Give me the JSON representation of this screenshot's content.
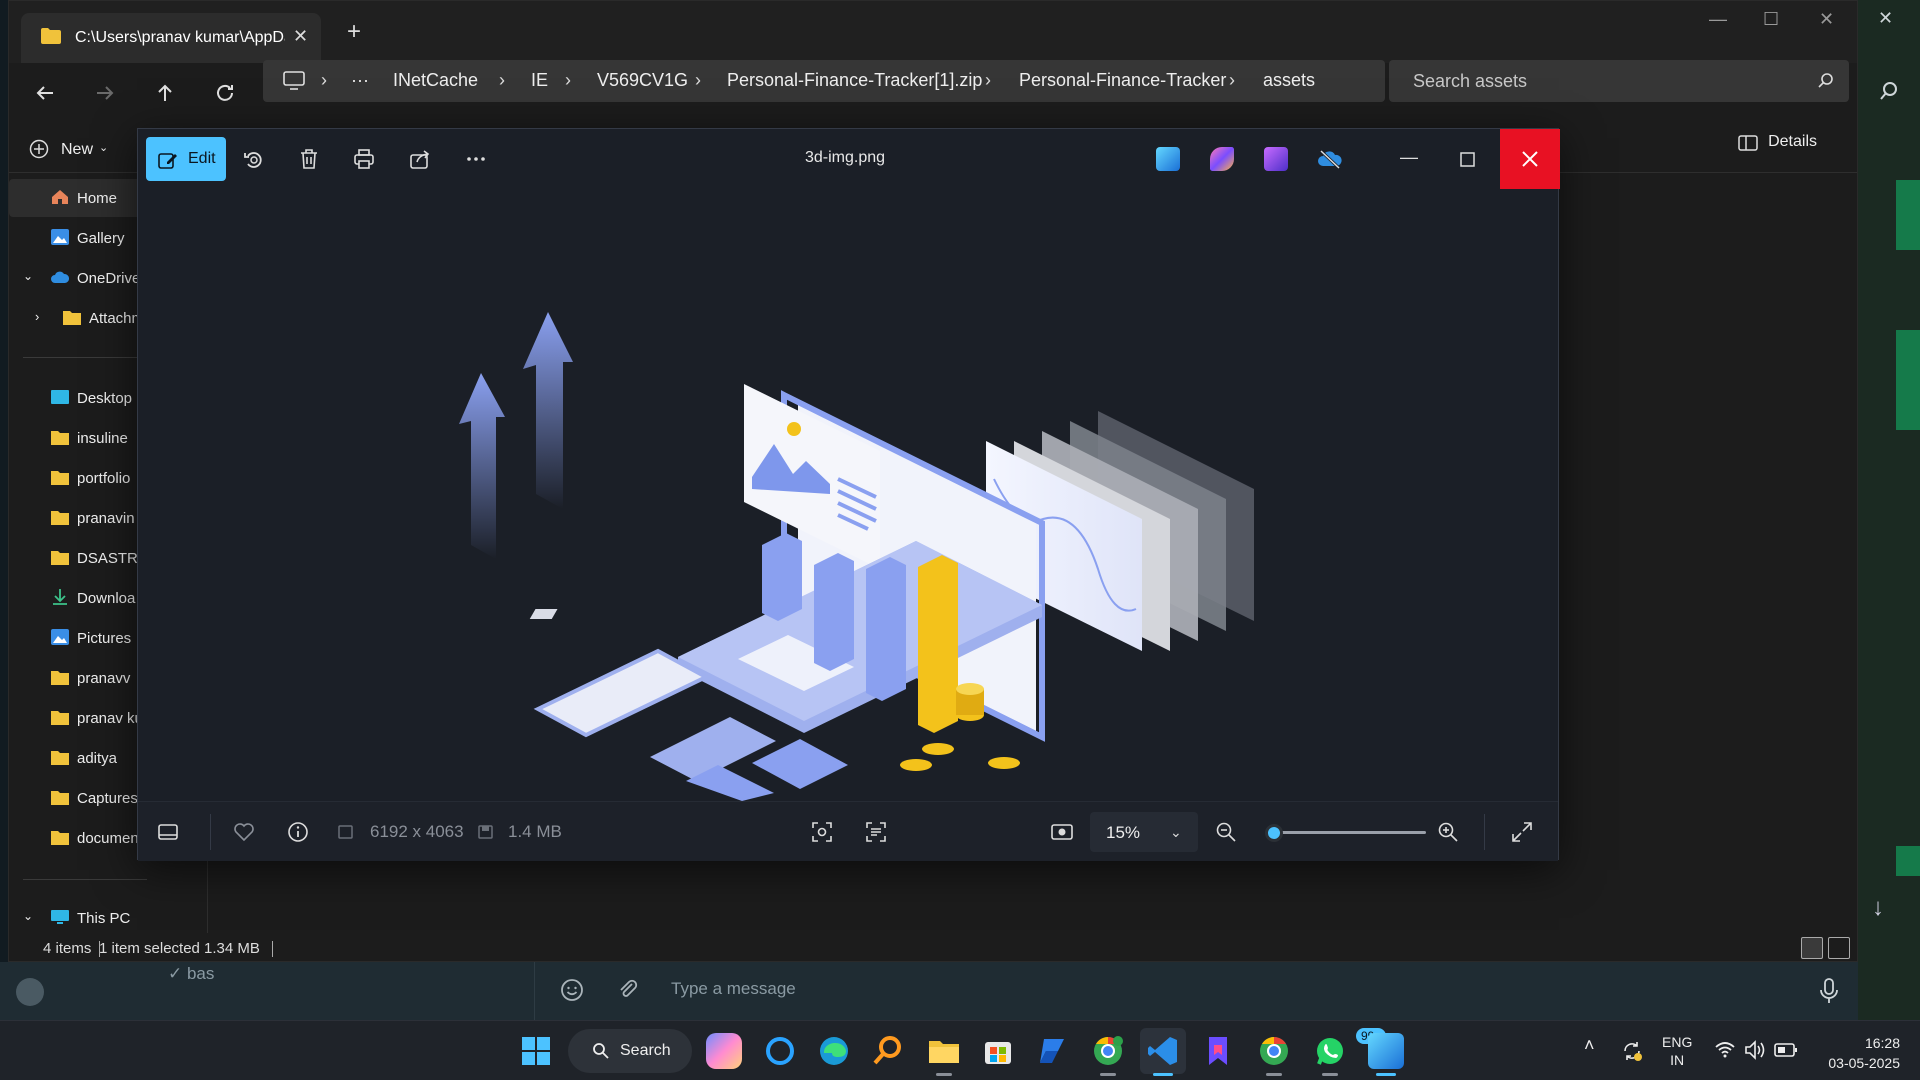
{
  "explorer": {
    "tab_title": "C:\\Users\\pranav kumar\\AppDa",
    "breadcrumb": [
      "INetCache",
      "IE",
      "V569CV1G",
      "Personal-Finance-Tracker[1].zip",
      "Personal-Finance-Tracker",
      "assets"
    ],
    "search_placeholder": "Search assets",
    "new_label": "New",
    "details_label": "Details",
    "sidebar": [
      {
        "label": "Home",
        "icon": "home-icon"
      },
      {
        "label": "Gallery",
        "icon": "gallery-icon"
      },
      {
        "label": "OneDrive",
        "icon": "cloud-icon"
      },
      {
        "label": "Attachm",
        "icon": "folder-icon"
      },
      {
        "label": "Desktop",
        "icon": "desktop-icon"
      },
      {
        "label": "insuline",
        "icon": "folder-icon"
      },
      {
        "label": "portfolio",
        "icon": "folder-icon"
      },
      {
        "label": "pranavin",
        "icon": "folder-icon"
      },
      {
        "label": "DSASTRI",
        "icon": "folder-icon"
      },
      {
        "label": "Downloa",
        "icon": "download-icon"
      },
      {
        "label": "Pictures",
        "icon": "pictures-icon"
      },
      {
        "label": "pranavv",
        "icon": "folder-icon"
      },
      {
        "label": "pranav ku",
        "icon": "folder-icon"
      },
      {
        "label": "aditya",
        "icon": "folder-icon"
      },
      {
        "label": "Captures",
        "icon": "folder-icon"
      },
      {
        "label": "documen",
        "icon": "folder-icon"
      },
      {
        "label": "This PC",
        "icon": "pc-icon"
      }
    ],
    "status": {
      "items": "4 items",
      "selected": "1 item selected  1.34 MB"
    }
  },
  "viewer": {
    "edit_label": "Edit",
    "file_name": "3d-img.png",
    "dimensions": "6192 x 4063",
    "file_size": "1.4 MB",
    "zoom_value": "15%",
    "zoom_fraction": 0.05
  },
  "background_app": {
    "chat_snippet": "bas",
    "message_placeholder": "Type a message"
  },
  "taskbar": {
    "search_label": "Search",
    "badge": "99+",
    "lang": "ENG",
    "region": "IN",
    "time": "16:28",
    "date": "03-05-2025"
  },
  "colors": {
    "accent": "#4cc2ff",
    "close_red": "#e81123",
    "folder_yellow": "#f0c23b"
  }
}
